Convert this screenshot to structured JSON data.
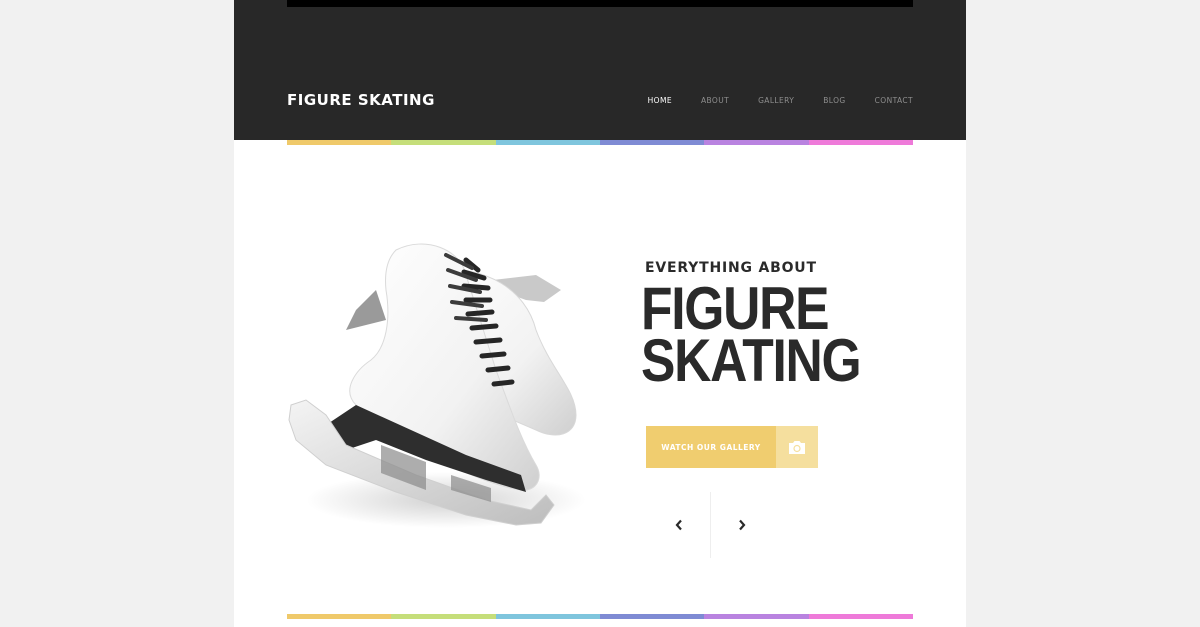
{
  "header": {
    "logo": "FIGURE SKATING",
    "nav": [
      {
        "label": "HOME",
        "active": true
      },
      {
        "label": "ABOUT",
        "active": false
      },
      {
        "label": "GALLERY",
        "active": false
      },
      {
        "label": "BLOG",
        "active": false
      },
      {
        "label": "CONTACT",
        "active": false
      }
    ]
  },
  "stripe_colors": [
    "#efc96a",
    "#c5de7a",
    "#7fc5dd",
    "#7f8bd4",
    "#b983e0",
    "#ee7ad9"
  ],
  "hero": {
    "subtitle": "EVERYTHING ABOUT",
    "title_line1": "FIGURE",
    "title_line2": "SKATING",
    "cta_label": "WATCH OUR GALLERY",
    "cta_icon": "camera-icon",
    "prev_icon": "chevron-left-icon",
    "next_icon": "chevron-right-icon"
  },
  "colors": {
    "header_bg": "#282828",
    "page_bg": "#f1f1f1",
    "cta": "#f0cd6f",
    "cta_icon_bg": "#f5df9e",
    "text_dark": "#2a2a2a"
  }
}
